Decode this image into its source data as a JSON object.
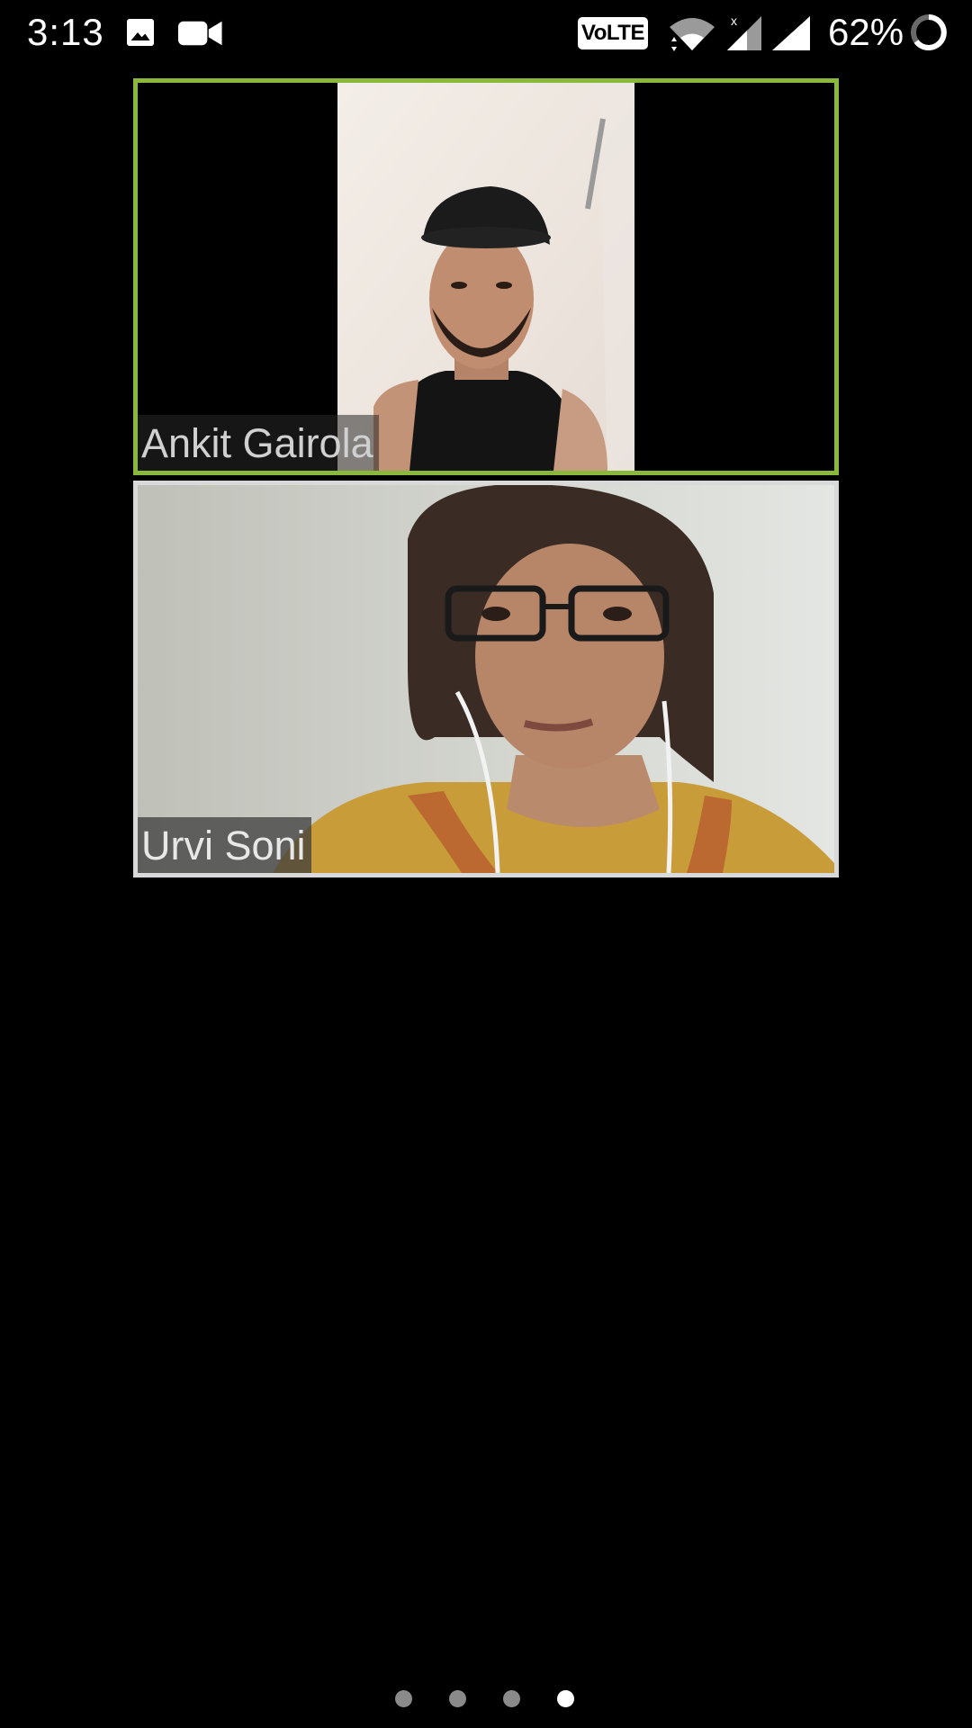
{
  "status_bar": {
    "time": "3:13",
    "volte": "VoLTE",
    "battery_percent": "62%",
    "icons": [
      "gallery-icon",
      "video-camera-icon",
      "wifi-icon",
      "signal-icon",
      "signal-icon",
      "battery-ring-icon"
    ]
  },
  "participants": [
    {
      "name": "Ankit Gairola",
      "active_speaker": true
    },
    {
      "name": "Urvi Soni",
      "active_speaker": false
    }
  ],
  "pager": {
    "total_pages": 4,
    "current_page": 4
  },
  "colors": {
    "active_speaker_border": "#8ab83a",
    "tile_border": "#d9d9d9",
    "background": "#000000"
  }
}
